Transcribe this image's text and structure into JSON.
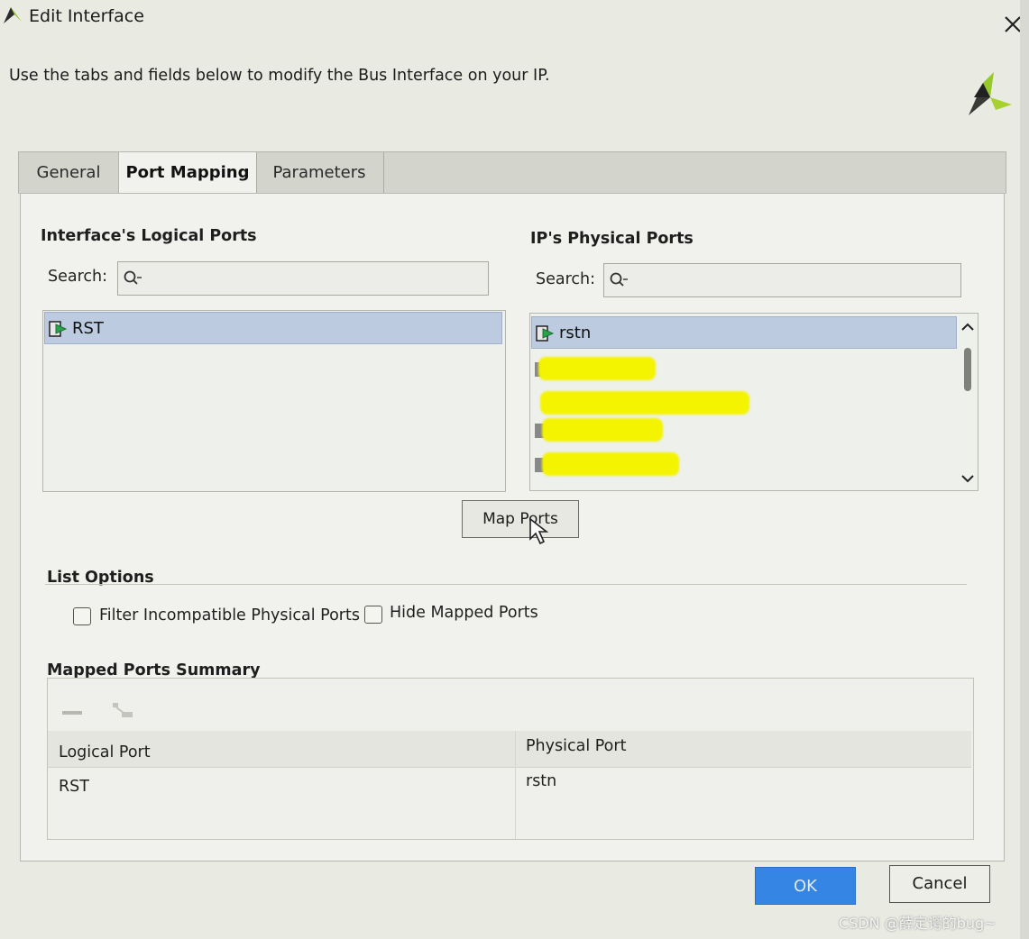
{
  "window": {
    "title": "Edit Interface",
    "instruction": "Use the tabs and fields below to modify the Bus Interface on your IP."
  },
  "tabs": [
    {
      "label": "General",
      "active": false
    },
    {
      "label": "Port Mapping",
      "active": true
    },
    {
      "label": "Parameters",
      "active": false
    }
  ],
  "logical_ports": {
    "heading": "Interface's Logical Ports",
    "search_label": "Search:",
    "search_value": "",
    "items": [
      {
        "label": "RST",
        "selected": true
      }
    ]
  },
  "physical_ports": {
    "heading": "IP's Physical Ports",
    "search_label": "Search:",
    "search_value": "",
    "items": [
      {
        "label": "rstn",
        "selected": true
      }
    ]
  },
  "map_ports_label": "Map Ports",
  "list_options": {
    "heading": "List Options",
    "filter_label": "Filter Incompatible Physical Ports",
    "filter_checked": false,
    "hide_label": "Hide Mapped Ports",
    "hide_checked": false
  },
  "summary": {
    "heading": "Mapped Ports Summary",
    "columns": [
      "Logical Port",
      "Physical Port"
    ],
    "rows": [
      [
        "RST",
        "rstn"
      ]
    ]
  },
  "buttons": {
    "ok": "OK",
    "cancel": "Cancel"
  },
  "watermark": "CSDN @薛定谔的bug~",
  "colors": {
    "accent": "#3585e4",
    "selection": "#bccbe0",
    "logo_green": "#8fc11f"
  }
}
